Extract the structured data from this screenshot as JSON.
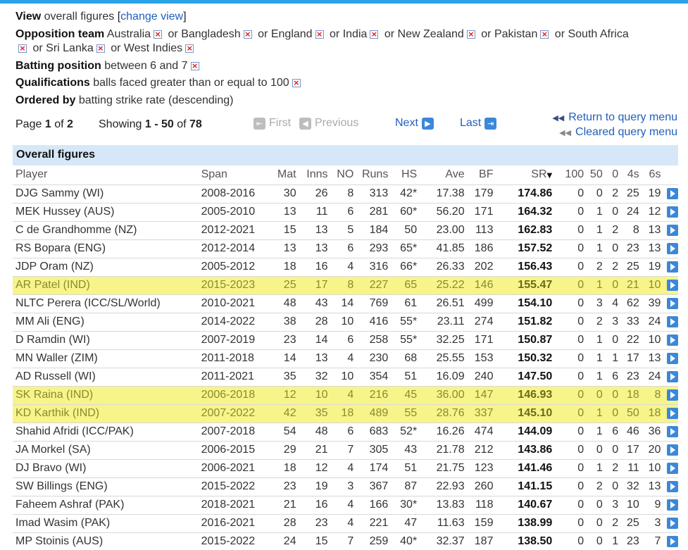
{
  "filters": {
    "view_label": "View",
    "view_value": "overall figures",
    "change_view_link": "change view",
    "opposition_label": "Opposition team",
    "opposition_teams": [
      "Australia",
      "Bangladesh",
      "England",
      "India",
      "New Zealand",
      "Pakistan",
      "South Africa",
      "Sri Lanka",
      "West Indies"
    ],
    "or_word": "or",
    "batting_position_label": "Batting position",
    "batting_position_value": "between 6 and 7",
    "qualifications_label": "Qualifications",
    "qualifications_value": "balls faced greater than or equal to 100",
    "ordered_by_label": "Ordered by",
    "ordered_by_value": "batting strike rate (descending)"
  },
  "pager": {
    "page_word": "Page",
    "page_current": "1",
    "of_word": "of",
    "page_total": "2",
    "showing_word": "Showing",
    "showing_from": "1",
    "dash": "-",
    "showing_to": "50",
    "showing_total": "78",
    "first_label": "First",
    "previous_label": "Previous",
    "next_label": "Next",
    "last_label": "Last",
    "return_link": "Return to query menu",
    "cleared_link": "Cleared query menu"
  },
  "table": {
    "caption": "Overall figures",
    "headers": [
      "Player",
      "Span",
      "Mat",
      "Inns",
      "NO",
      "Runs",
      "HS",
      "Ave",
      "BF",
      "SR",
      "100",
      "50",
      "0",
      "4s",
      "6s"
    ],
    "rows": [
      {
        "player": "DJG Sammy (WI)",
        "span": "2008-2016",
        "mat": "30",
        "inns": "26",
        "no": "8",
        "runs": "313",
        "hs": "42*",
        "ave": "17.38",
        "bf": "179",
        "sr": "174.86",
        "c100": "0",
        "c50": "0",
        "c0": "2",
        "fours": "25",
        "sixes": "19",
        "highlighted": false
      },
      {
        "player": "MEK Hussey (AUS)",
        "span": "2005-2010",
        "mat": "13",
        "inns": "11",
        "no": "6",
        "runs": "281",
        "hs": "60*",
        "ave": "56.20",
        "bf": "171",
        "sr": "164.32",
        "c100": "0",
        "c50": "1",
        "c0": "0",
        "fours": "24",
        "sixes": "12",
        "highlighted": false
      },
      {
        "player": "C de Grandhomme (NZ)",
        "span": "2012-2021",
        "mat": "15",
        "inns": "13",
        "no": "5",
        "runs": "184",
        "hs": "50",
        "ave": "23.00",
        "bf": "113",
        "sr": "162.83",
        "c100": "0",
        "c50": "1",
        "c0": "2",
        "fours": "8",
        "sixes": "13",
        "highlighted": false
      },
      {
        "player": "RS Bopara (ENG)",
        "span": "2012-2014",
        "mat": "13",
        "inns": "13",
        "no": "6",
        "runs": "293",
        "hs": "65*",
        "ave": "41.85",
        "bf": "186",
        "sr": "157.52",
        "c100": "0",
        "c50": "1",
        "c0": "0",
        "fours": "23",
        "sixes": "13",
        "highlighted": false
      },
      {
        "player": "JDP Oram (NZ)",
        "span": "2005-2012",
        "mat": "18",
        "inns": "16",
        "no": "4",
        "runs": "316",
        "hs": "66*",
        "ave": "26.33",
        "bf": "202",
        "sr": "156.43",
        "c100": "0",
        "c50": "2",
        "c0": "2",
        "fours": "25",
        "sixes": "19",
        "highlighted": false
      },
      {
        "player": "AR Patel (IND)",
        "span": "2015-2023",
        "mat": "25",
        "inns": "17",
        "no": "8",
        "runs": "227",
        "hs": "65",
        "ave": "25.22",
        "bf": "146",
        "sr": "155.47",
        "c100": "0",
        "c50": "1",
        "c0": "0",
        "fours": "21",
        "sixes": "10",
        "highlighted": true
      },
      {
        "player": "NLTC Perera (ICC/SL/World)",
        "span": "2010-2021",
        "mat": "48",
        "inns": "43",
        "no": "14",
        "runs": "769",
        "hs": "61",
        "ave": "26.51",
        "bf": "499",
        "sr": "154.10",
        "c100": "0",
        "c50": "3",
        "c0": "4",
        "fours": "62",
        "sixes": "39",
        "highlighted": false
      },
      {
        "player": "MM Ali (ENG)",
        "span": "2014-2022",
        "mat": "38",
        "inns": "28",
        "no": "10",
        "runs": "416",
        "hs": "55*",
        "ave": "23.11",
        "bf": "274",
        "sr": "151.82",
        "c100": "0",
        "c50": "2",
        "c0": "3",
        "fours": "33",
        "sixes": "24",
        "highlighted": false
      },
      {
        "player": "D Ramdin (WI)",
        "span": "2007-2019",
        "mat": "23",
        "inns": "14",
        "no": "6",
        "runs": "258",
        "hs": "55*",
        "ave": "32.25",
        "bf": "171",
        "sr": "150.87",
        "c100": "0",
        "c50": "1",
        "c0": "0",
        "fours": "22",
        "sixes": "10",
        "highlighted": false
      },
      {
        "player": "MN Waller (ZIM)",
        "span": "2011-2018",
        "mat": "14",
        "inns": "13",
        "no": "4",
        "runs": "230",
        "hs": "68",
        "ave": "25.55",
        "bf": "153",
        "sr": "150.32",
        "c100": "0",
        "c50": "1",
        "c0": "1",
        "fours": "17",
        "sixes": "13",
        "highlighted": false
      },
      {
        "player": "AD Russell (WI)",
        "span": "2011-2021",
        "mat": "35",
        "inns": "32",
        "no": "10",
        "runs": "354",
        "hs": "51",
        "ave": "16.09",
        "bf": "240",
        "sr": "147.50",
        "c100": "0",
        "c50": "1",
        "c0": "6",
        "fours": "23",
        "sixes": "24",
        "highlighted": false
      },
      {
        "player": "SK Raina (IND)",
        "span": "2006-2018",
        "mat": "12",
        "inns": "10",
        "no": "4",
        "runs": "216",
        "hs": "45",
        "ave": "36.00",
        "bf": "147",
        "sr": "146.93",
        "c100": "0",
        "c50": "0",
        "c0": "0",
        "fours": "18",
        "sixes": "8",
        "highlighted": true
      },
      {
        "player": "KD Karthik (IND)",
        "span": "2007-2022",
        "mat": "42",
        "inns": "35",
        "no": "18",
        "runs": "489",
        "hs": "55",
        "ave": "28.76",
        "bf": "337",
        "sr": "145.10",
        "c100": "0",
        "c50": "1",
        "c0": "0",
        "fours": "50",
        "sixes": "18",
        "highlighted": true
      },
      {
        "player": "Shahid Afridi (ICC/PAK)",
        "span": "2007-2018",
        "mat": "54",
        "inns": "48",
        "no": "6",
        "runs": "683",
        "hs": "52*",
        "ave": "16.26",
        "bf": "474",
        "sr": "144.09",
        "c100": "0",
        "c50": "1",
        "c0": "6",
        "fours": "46",
        "sixes": "36",
        "highlighted": false
      },
      {
        "player": "JA Morkel (SA)",
        "span": "2006-2015",
        "mat": "29",
        "inns": "21",
        "no": "7",
        "runs": "305",
        "hs": "43",
        "ave": "21.78",
        "bf": "212",
        "sr": "143.86",
        "c100": "0",
        "c50": "0",
        "c0": "0",
        "fours": "17",
        "sixes": "20",
        "highlighted": false
      },
      {
        "player": "DJ Bravo (WI)",
        "span": "2006-2021",
        "mat": "18",
        "inns": "12",
        "no": "4",
        "runs": "174",
        "hs": "51",
        "ave": "21.75",
        "bf": "123",
        "sr": "141.46",
        "c100": "0",
        "c50": "1",
        "c0": "2",
        "fours": "11",
        "sixes": "10",
        "highlighted": false
      },
      {
        "player": "SW Billings (ENG)",
        "span": "2015-2022",
        "mat": "23",
        "inns": "19",
        "no": "3",
        "runs": "367",
        "hs": "87",
        "ave": "22.93",
        "bf": "260",
        "sr": "141.15",
        "c100": "0",
        "c50": "2",
        "c0": "0",
        "fours": "32",
        "sixes": "13",
        "highlighted": false
      },
      {
        "player": "Faheem Ashraf (PAK)",
        "span": "2018-2021",
        "mat": "21",
        "inns": "16",
        "no": "4",
        "runs": "166",
        "hs": "30*",
        "ave": "13.83",
        "bf": "118",
        "sr": "140.67",
        "c100": "0",
        "c50": "0",
        "c0": "3",
        "fours": "10",
        "sixes": "9",
        "highlighted": false
      },
      {
        "player": "Imad Wasim (PAK)",
        "span": "2016-2021",
        "mat": "28",
        "inns": "23",
        "no": "4",
        "runs": "221",
        "hs": "47",
        "ave": "11.63",
        "bf": "159",
        "sr": "138.99",
        "c100": "0",
        "c50": "0",
        "c0": "2",
        "fours": "25",
        "sixes": "3",
        "highlighted": false
      },
      {
        "player": "MP Stoinis (AUS)",
        "span": "2015-2022",
        "mat": "24",
        "inns": "15",
        "no": "7",
        "runs": "259",
        "hs": "40*",
        "ave": "32.37",
        "bf": "187",
        "sr": "138.50",
        "c100": "0",
        "c50": "0",
        "c0": "1",
        "fours": "23",
        "sixes": "7",
        "highlighted": false
      }
    ]
  },
  "colors": {
    "link": "#1f5fbd",
    "caption_bg": "#d6e8f7",
    "highlight": "#f7f48a",
    "nav_button": "#3b88d9",
    "top_bar": "#2aa3e8"
  },
  "icons": {
    "remove_filter": "remove-x-icon",
    "row_go": "play-arrow-icon",
    "sort": "sort-down-icon"
  }
}
